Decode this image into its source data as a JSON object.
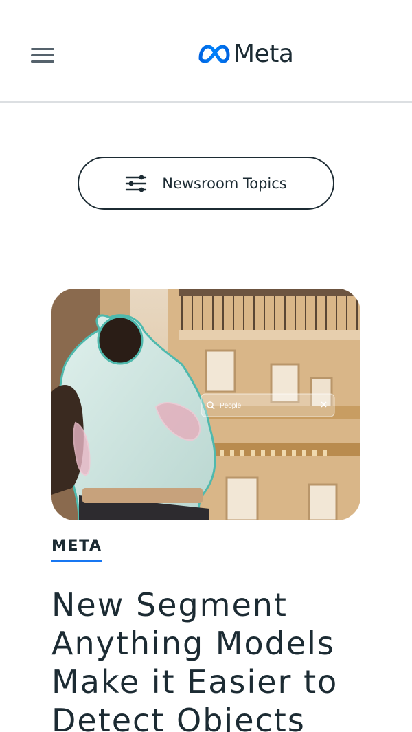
{
  "header": {
    "menu_icon": "hamburger-menu-icon",
    "logo_text": "Meta",
    "logo_icon": "meta-infinity-logo",
    "brand_color": "#0081fb"
  },
  "topics_button": {
    "label": "Newsroom Topics",
    "icon": "filter-sliders-icon"
  },
  "article": {
    "image_search_placeholder": "People",
    "category": "META",
    "title": "New Segment Anything Models Make it Easier to Detect Objects",
    "accent_color": "#1877f2"
  }
}
